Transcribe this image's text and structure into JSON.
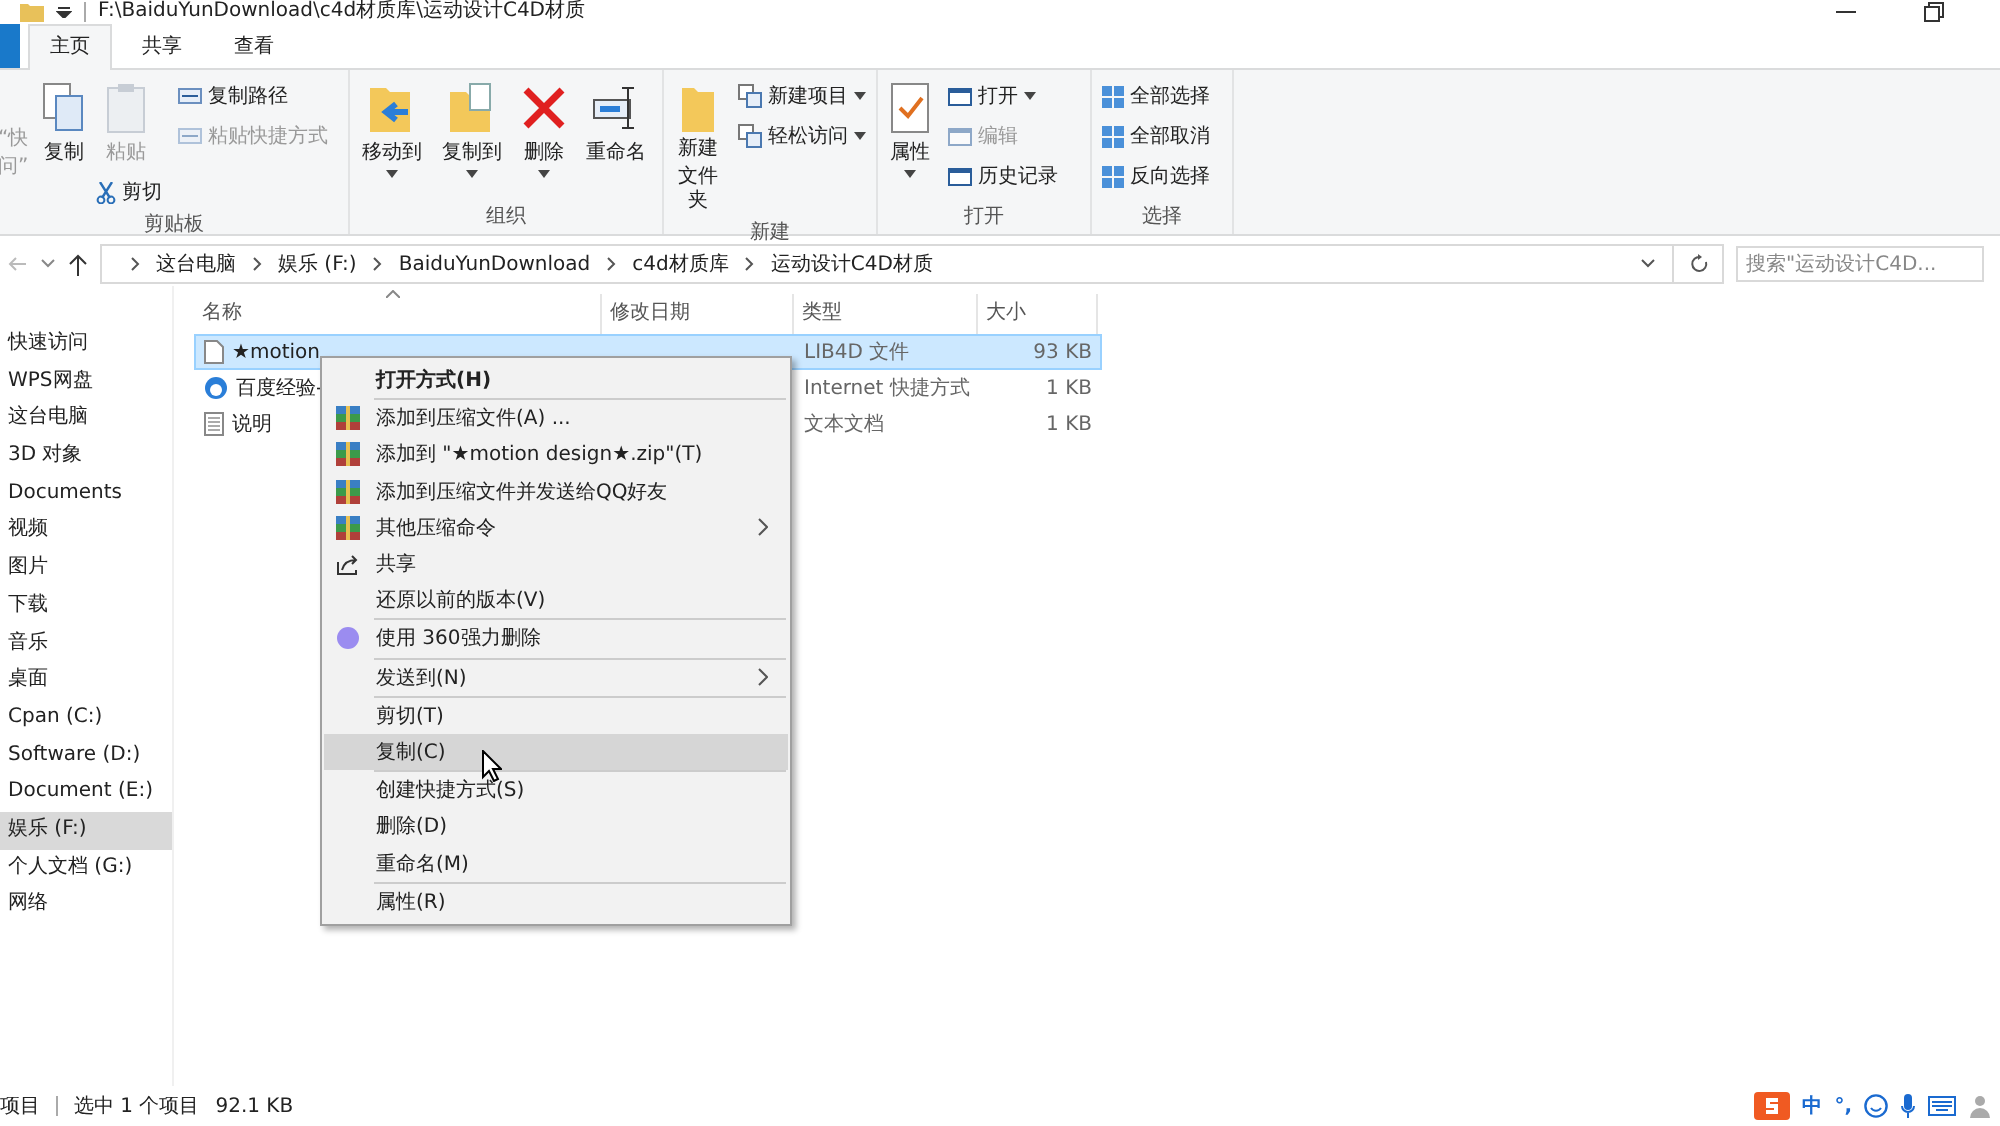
{
  "title_bar": {
    "path": "F:\\BaiduYunDownload\\c4d材质库\\运动设计C4D材质"
  },
  "tabs": [
    {
      "label": "主页",
      "selected": true
    },
    {
      "label": "共享",
      "selected": false
    },
    {
      "label": "查看",
      "selected": false
    }
  ],
  "ribbon": {
    "groups": [
      {
        "label": "剪贴板",
        "cut_lines": [
          "“快",
          "问”"
        ],
        "large": [
          {
            "label": "复制",
            "disabled": false
          },
          {
            "label": "粘贴",
            "disabled": true
          }
        ],
        "small": [
          {
            "label": "复制路径",
            "disabled": false
          },
          {
            "label": "粘贴快捷方式",
            "disabled": true
          }
        ],
        "cut": {
          "label": "剪切",
          "disabled": false
        }
      },
      {
        "label": "组织",
        "large": [
          {
            "label": "移动到",
            "dropdown": true
          },
          {
            "label": "复制到",
            "dropdown": true
          },
          {
            "label": "删除",
            "dropdown": true
          },
          {
            "label": "重命名",
            "dropdown": false
          }
        ]
      },
      {
        "label": "新建",
        "large": [
          {
            "lines": [
              "新建",
              "文件夹"
            ],
            "dropdown": false
          }
        ],
        "small": [
          {
            "label": "新建项目",
            "dropdown": true
          },
          {
            "label": "轻松访问",
            "dropdown": true
          }
        ]
      },
      {
        "label": "打开",
        "large": [
          {
            "label": "属性",
            "dropdown": true
          }
        ],
        "small": [
          {
            "label": "打开",
            "dropdown": true,
            "disabled": false
          },
          {
            "label": "编辑",
            "dropdown": false,
            "disabled": true
          },
          {
            "label": "历史记录",
            "dropdown": false,
            "disabled": false
          }
        ]
      },
      {
        "label": "选择",
        "small": [
          {
            "label": "全部选择"
          },
          {
            "label": "全部取消"
          },
          {
            "label": "反向选择"
          }
        ]
      }
    ]
  },
  "address": {
    "crumbs": [
      "这台电脑",
      "娱乐 (F:)",
      "BaiduYunDownload",
      "c4d材质库",
      "运动设计C4D材质"
    ],
    "search_placeholder": "搜索\"运动设计C4D..."
  },
  "nav": [
    {
      "label": "快速访问",
      "selected": false
    },
    {
      "label": "WPS网盘",
      "selected": false
    },
    {
      "label": "这台电脑",
      "selected": false
    },
    {
      "label": "3D 对象",
      "selected": false
    },
    {
      "label": "Documents",
      "selected": false
    },
    {
      "label": "视频",
      "selected": false
    },
    {
      "label": "图片",
      "selected": false
    },
    {
      "label": "下载",
      "selected": false
    },
    {
      "label": "音乐",
      "selected": false
    },
    {
      "label": "桌面",
      "selected": false
    },
    {
      "label": "Cpan (C:)",
      "selected": false
    },
    {
      "label": "Software (D:)",
      "selected": false
    },
    {
      "label": "Document (E:)",
      "selected": false
    },
    {
      "label": "娱乐 (F:)",
      "selected": true
    },
    {
      "label": "个人文档 (G:)",
      "selected": false
    },
    {
      "label": "网络",
      "selected": false
    }
  ],
  "columns": [
    "名称",
    "修改日期",
    "类型",
    "大小"
  ],
  "files": [
    {
      "kind": "file",
      "name": "★motion",
      "type": "LIB4D 文件",
      "size": "93 KB",
      "selected": true
    },
    {
      "kind": "link",
      "name": "百度经验-",
      "type": "Internet 快捷方式",
      "size": "1 KB",
      "selected": false
    },
    {
      "kind": "text",
      "name": "说明",
      "type": "文本文档",
      "size": "1 KB",
      "selected": false
    }
  ],
  "context_menu": [
    {
      "kind": "header",
      "label": "打开方式(H)",
      "selected": false
    },
    {
      "kind": "separator"
    },
    {
      "kind": "archive",
      "label": "添加到压缩文件(A) ...",
      "submenu": false,
      "selected": false
    },
    {
      "kind": "archive",
      "label": "添加到 \"★motion design★.zip\"(T)",
      "submenu": false,
      "selected": false
    },
    {
      "kind": "archive",
      "label": "添加到压缩文件并发送给QQ好友",
      "submenu": false,
      "selected": false
    },
    {
      "kind": "archive",
      "label": "其他压缩命令",
      "submenu": true,
      "selected": false
    },
    {
      "kind": "share",
      "label": "共享",
      "submenu": false,
      "selected": false
    },
    {
      "kind": "plain",
      "label": "还原以前的版本(V)",
      "submenu": false,
      "selected": false
    },
    {
      "kind": "separator"
    },
    {
      "kind": "shred",
      "label": "使用 360强力删除",
      "submenu": false,
      "selected": false
    },
    {
      "kind": "separator"
    },
    {
      "kind": "plain",
      "label": "发送到(N)",
      "submenu": true,
      "selected": false
    },
    {
      "kind": "separator"
    },
    {
      "kind": "plain",
      "label": "剪切(T)",
      "submenu": false,
      "selected": false
    },
    {
      "kind": "plain",
      "label": "复制(C)",
      "submenu": false,
      "selected": true
    },
    {
      "kind": "separator"
    },
    {
      "kind": "plain",
      "label": "创建快捷方式(S)",
      "submenu": false,
      "selected": false
    },
    {
      "kind": "plain",
      "label": "删除(D)",
      "submenu": false,
      "selected": false
    },
    {
      "kind": "plain",
      "label": "重命名(M)",
      "submenu": false,
      "selected": false
    },
    {
      "kind": "separator"
    },
    {
      "kind": "plain",
      "label": "属性(R)",
      "submenu": false,
      "selected": false
    }
  ],
  "status_bar": {
    "count": "项目",
    "selection": "选中 1 个项目",
    "size": "92.1 KB"
  },
  "ime": {
    "mode": "中",
    "punct": "°,"
  }
}
